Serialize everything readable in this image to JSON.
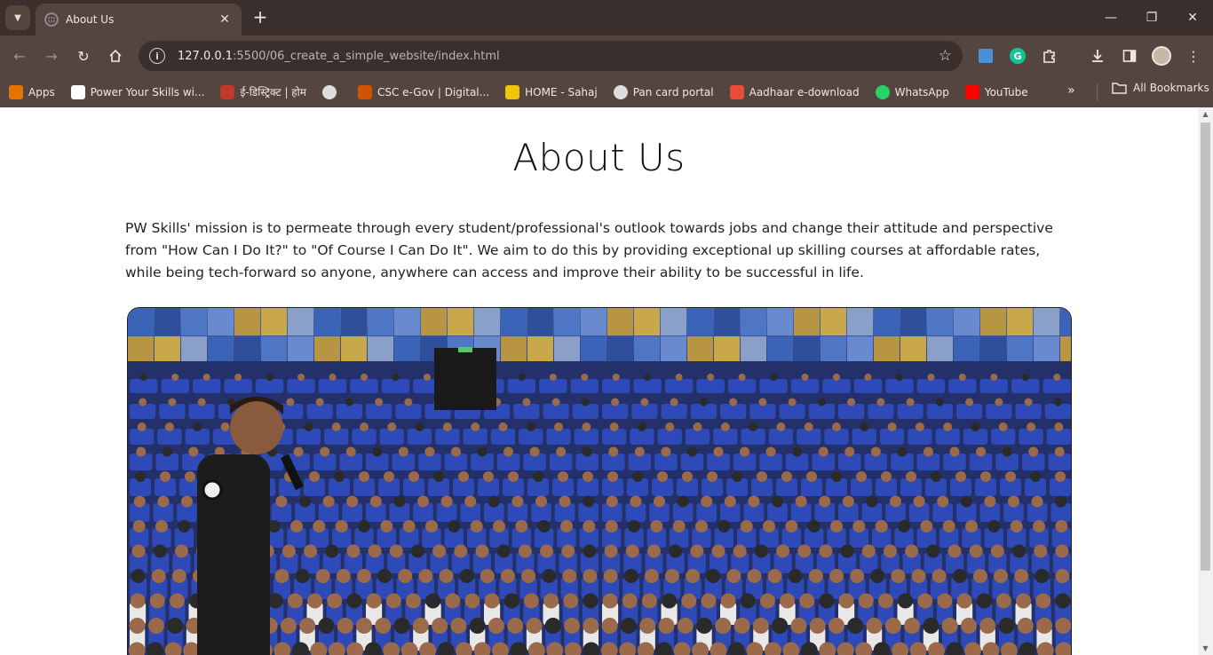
{
  "browser": {
    "tab": {
      "title": "About Us"
    },
    "url": {
      "host": "127.0.0.1",
      "path": ":5500/06_create_a_simple_website/index.html"
    },
    "bookmarks": [
      {
        "label": "Apps",
        "icon": "apps-grid-icon",
        "color": "#e37400"
      },
      {
        "label": "Power Your Skills wi...",
        "icon": "pw-logo-icon",
        "color": "#ffffff"
      },
      {
        "label": "ई-डिस्ट्रिक्ट | होम",
        "icon": "edistrict-icon",
        "color": "#c0392b"
      },
      {
        "label": "",
        "icon": "globe-icon",
        "color": "#dddddd"
      },
      {
        "label": "CSC e-Gov | Digital...",
        "icon": "csc-icon",
        "color": "#d35400"
      },
      {
        "label": "HOME - Sahaj",
        "icon": "sahaj-icon",
        "color": "#f1c40f"
      },
      {
        "label": "Pan card portal",
        "icon": "globe-icon",
        "color": "#dddddd"
      },
      {
        "label": "Aadhaar e-download",
        "icon": "aadhaar-icon",
        "color": "#e74c3c"
      },
      {
        "label": "WhatsApp",
        "icon": "whatsapp-icon",
        "color": "#25d366"
      },
      {
        "label": "YouTube",
        "icon": "youtube-icon",
        "color": "#ff0000"
      }
    ],
    "all_bookmarks": "All Bookmarks"
  },
  "page": {
    "title": "About Us",
    "mission": "PW Skills' mission is to permeate through every student/professional's outlook towards jobs and change their attitude and perspective from \"How Can I Do It?\" to \"Of Course I Can Do It\". We aim to do this by providing exceptional up skilling courses at affordable rates, while being tech-forward so anyone, anywhere can access and improve their ability to be successful in life."
  }
}
